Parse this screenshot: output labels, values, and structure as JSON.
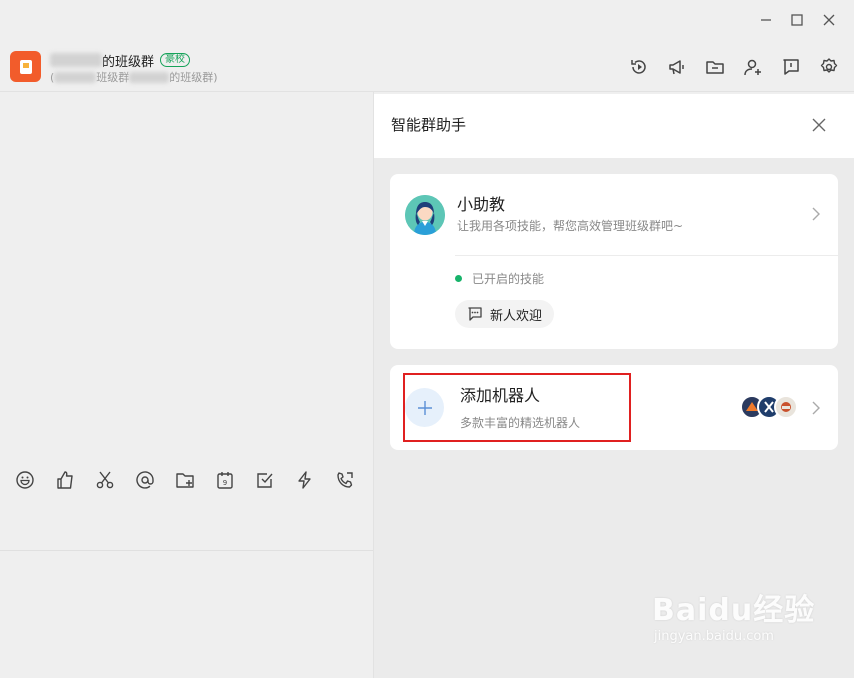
{
  "window": {
    "minimize_icon": "minimize-icon",
    "maximize_icon": "maximize-icon",
    "close_icon": "close-icon"
  },
  "header": {
    "group_name": "的班级群",
    "badge": "豪校",
    "group_sub_prefix": "(",
    "group_sub_mid": "班级群",
    "group_sub_suffix": "的班级群)",
    "icons": [
      "history-icon",
      "announcement-icon",
      "folder-icon",
      "add-member-icon",
      "message-square-icon",
      "settings-icon"
    ]
  },
  "toolbar": {
    "icons": [
      "emoji-icon",
      "like-icon",
      "scissors-icon",
      "mention-icon",
      "folder-add-icon",
      "calendar-icon",
      "checkbox-icon",
      "lightning-icon",
      "phone-video-icon"
    ]
  },
  "panel": {
    "title": "智能群助手",
    "assistant": {
      "name": "小助教",
      "desc": "让我用各项技能，帮您高效管理班级群吧~",
      "skills_label": "已开启的技能",
      "skill_chip": "新人欢迎"
    },
    "add_bot": {
      "title": "添加机器人",
      "desc": "多款丰富的精选机器人"
    }
  },
  "watermark": {
    "main": "Baidu经验",
    "sub": "jingyan.baidu.com"
  },
  "colors": {
    "accent_green": "#17b36a",
    "highlight_red": "#e02020",
    "logo_orange": "#f25c2b"
  }
}
